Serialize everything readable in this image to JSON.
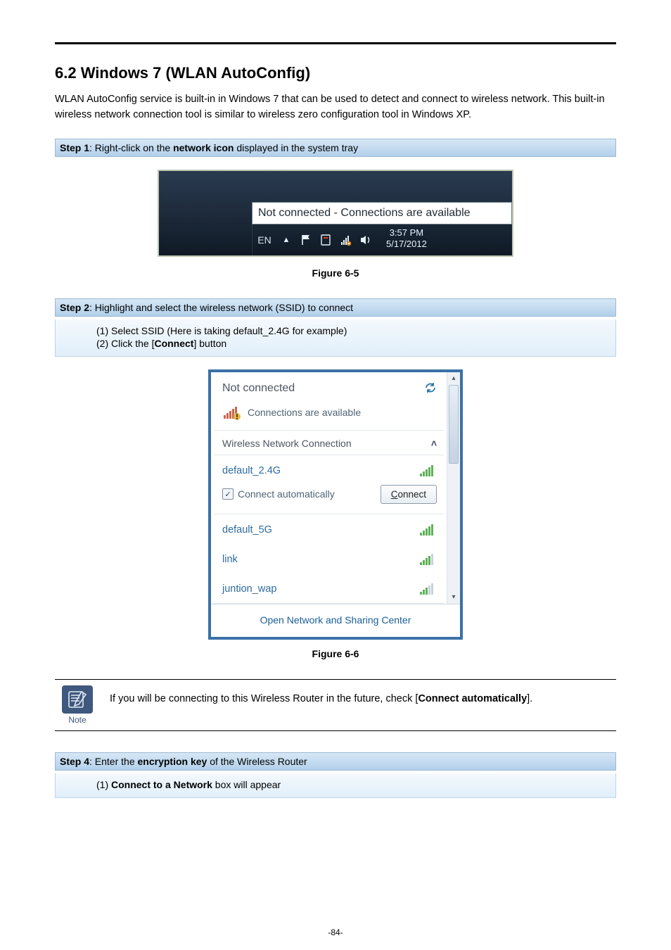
{
  "doc": {
    "heading": "6.2  Windows 7 (WLAN AutoConfig)",
    "intro": "WLAN AutoConfig service is built-in in Windows 7 that can be used to detect and connect to wireless network. This built-in wireless network connection tool is similar to wireless zero configuration tool in Windows XP.",
    "step1": {
      "prefix": "Step 1",
      "text_a": ": Right-click on the ",
      "bold_a": "network icon",
      "text_b": " displayed in the system tray"
    },
    "fig1_caption": "Figure 6-5",
    "step2": {
      "prefix": "Step 2",
      "text": ": Highlight and select the wireless network (SSID) to connect",
      "line1": "(1)  Select SSID (Here is taking default_2.4G for example)",
      "line2_a": "(2)  Click the [",
      "line2_bold": "Connect",
      "line2_b": "] button"
    },
    "fig2_caption": "Figure 6-6",
    "note_label": "Note",
    "note_text_a": "If you will be connecting to this Wireless Router in the future, check [",
    "note_bold_a": "Connect automatically",
    "note_text_b": "].",
    "step4": {
      "prefix": "Step 4",
      "text_a": ": Enter the ",
      "bold_a": "encryption key",
      "text_b": " of the Wireless Router",
      "line1_a": "(1)  ",
      "line1_bold": "Connect to a Network",
      "line1_b": " box will appear"
    },
    "page_number": "-84-"
  },
  "taskbar": {
    "tooltip": "Not connected - Connections are available",
    "lang": "EN",
    "time": "3:57 PM",
    "date": "5/17/2012"
  },
  "flyout": {
    "title": "Not connected",
    "avail": "Connections are available",
    "section": "Wireless Network Connection",
    "auto_label": "Connect automatically",
    "connect_btn": "Connect",
    "footer": "Open Network and Sharing Center",
    "networks": [
      {
        "name": "default_2.4G",
        "strength": 5,
        "selected": true
      },
      {
        "name": "default_5G",
        "strength": 5,
        "selected": false
      },
      {
        "name": "link",
        "strength": 4,
        "selected": false
      },
      {
        "name": "juntion_wap",
        "strength": 3,
        "selected": false
      }
    ]
  }
}
